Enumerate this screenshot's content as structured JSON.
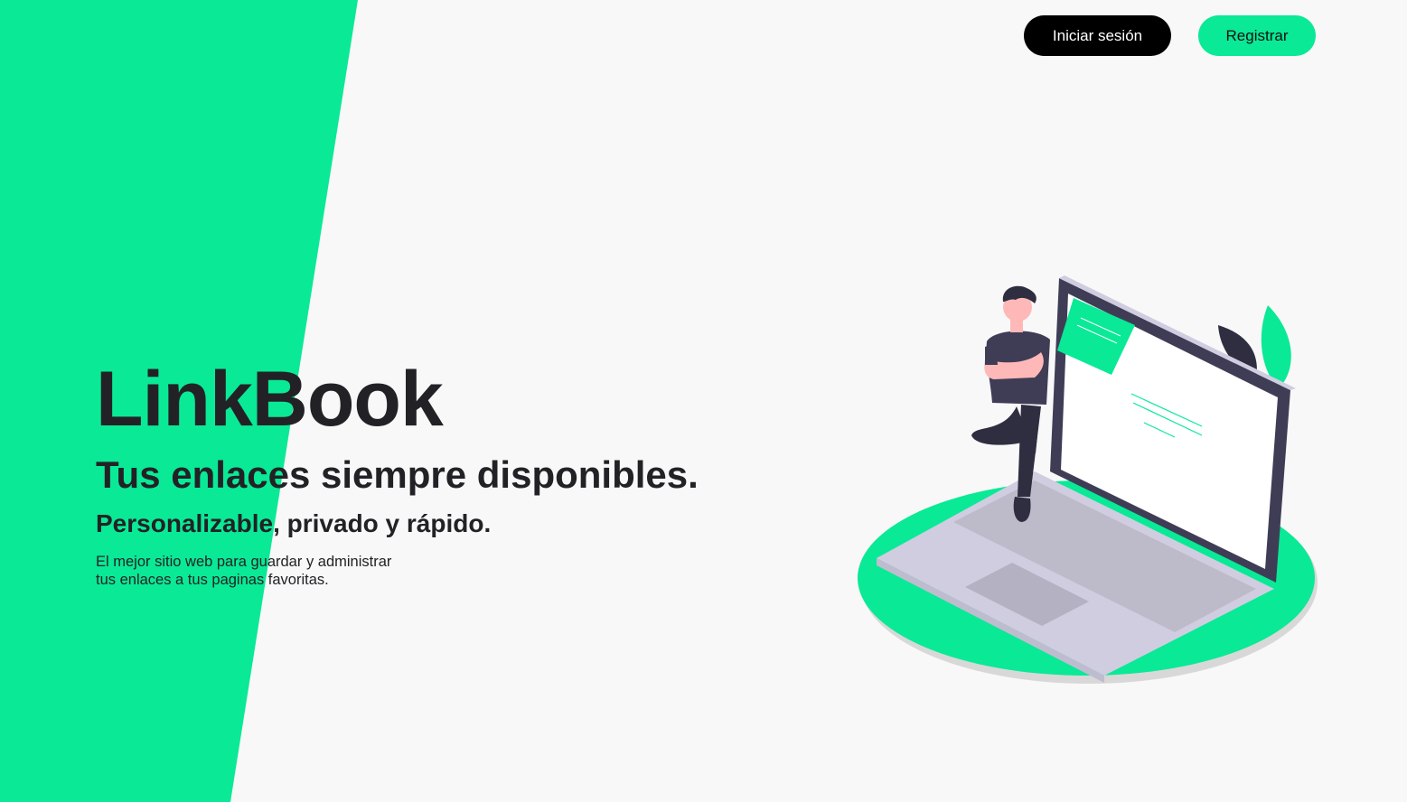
{
  "nav": {
    "login_label": "Iniciar sesión",
    "register_label": "Registrar"
  },
  "hero": {
    "title": "LinkBook",
    "subtitle": "Tus enlaces siempre disponibles.",
    "tagline": "Personalizable, privado y rápido.",
    "description_line1": "El mejor sitio web para guardar y administrar",
    "description_line2": "tus enlaces a tus paginas favoritas."
  },
  "colors": {
    "accent": "#0ae996",
    "background": "#f8f8f8",
    "text": "#222226",
    "button_dark": "#000000"
  },
  "illustration": {
    "name": "person-with-laptop-illustration"
  }
}
